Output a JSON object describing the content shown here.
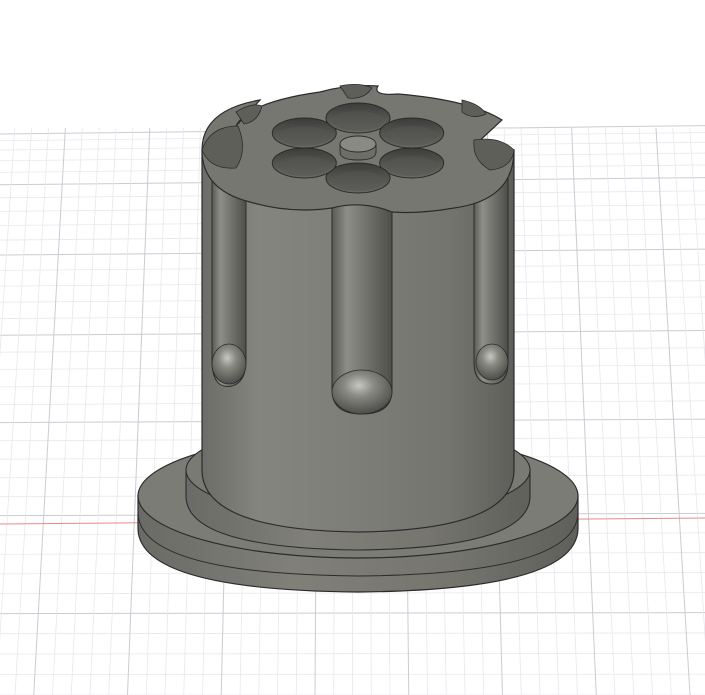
{
  "viewport": {
    "name": "3d-model-viewport",
    "background_color": "#ffffff",
    "grid": {
      "visible": true,
      "minor_line_color": "#e6e8ec",
      "major_line_color": "#c9ccd2",
      "x_axis_color": "#e78a8a"
    },
    "model": {
      "name": "revolver-cylinder-holder",
      "body_color": "#7a7a75",
      "shade_dark": "#4f4f4c",
      "shade_light": "#969690",
      "edge_color": "#2b2b2b",
      "chamber_count": 6,
      "flute_count": 6
    }
  }
}
